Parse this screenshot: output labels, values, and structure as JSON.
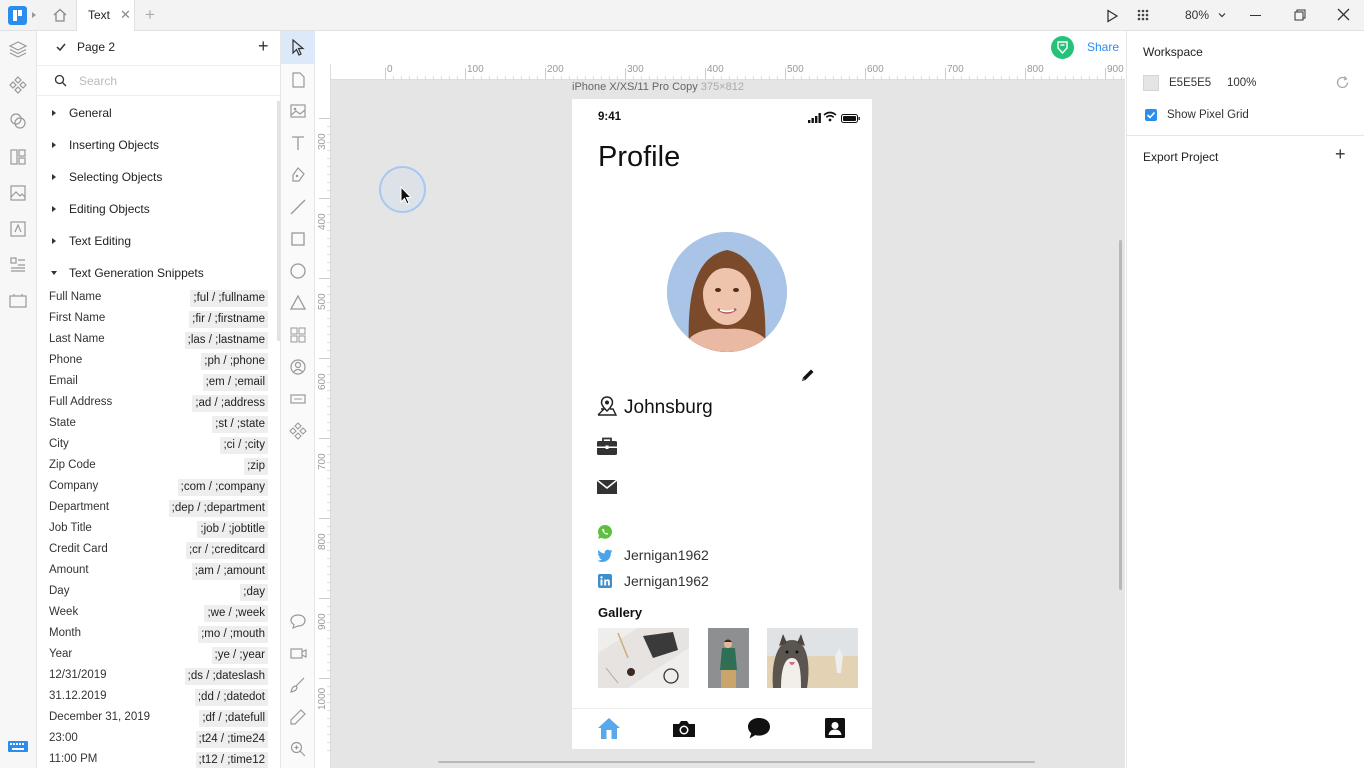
{
  "window": {
    "tab_title": "Text",
    "zoom": "80%"
  },
  "toolbar": {
    "share_label": "Share"
  },
  "left_panel": {
    "page_name": "Page 2",
    "search_placeholder": "Search",
    "sections": [
      {
        "label": "General",
        "expanded": false
      },
      {
        "label": "Inserting Objects",
        "expanded": false
      },
      {
        "label": "Selecting Objects",
        "expanded": false
      },
      {
        "label": "Editing Objects",
        "expanded": false
      },
      {
        "label": "Text Editing",
        "expanded": false
      },
      {
        "label": "Text Generation Snippets",
        "expanded": true
      }
    ],
    "snippets": [
      {
        "name": "Full Name",
        "code": ";ful / ;fullname"
      },
      {
        "name": "First Name",
        "code": ";fir / ;firstname"
      },
      {
        "name": "Last Name",
        "code": ";las / ;lastname"
      },
      {
        "name": "Phone",
        "code": ";ph / ;phone"
      },
      {
        "name": "Email",
        "code": ";em / ;email"
      },
      {
        "name": "Full Address",
        "code": ";ad / ;address"
      },
      {
        "name": "State",
        "code": ";st / ;state"
      },
      {
        "name": "City",
        "code": ";ci / ;city"
      },
      {
        "name": "Zip Code",
        "code": ";zip"
      },
      {
        "name": "Company",
        "code": ";com / ;company"
      },
      {
        "name": "Department",
        "code": ";dep / ;department"
      },
      {
        "name": "Job Title",
        "code": ";job / ;jobtitle"
      },
      {
        "name": "Credit Card",
        "code": ";cr / ;creditcard"
      },
      {
        "name": "Amount",
        "code": ";am / ;amount"
      },
      {
        "name": "Day",
        "code": ";day"
      },
      {
        "name": "Week",
        "code": ";we / ;week"
      },
      {
        "name": "Month",
        "code": ";mo / ;mouth"
      },
      {
        "name": "Year",
        "code": ";ye / ;year"
      },
      {
        "name": "12/31/2019",
        "code": ";ds / ;dateslash"
      },
      {
        "name": "31.12.2019",
        "code": ";dd / ;datedot"
      },
      {
        "name": "December 31, 2019",
        "code": ";df / ;datefull"
      },
      {
        "name": "23:00",
        "code": ";t24 / ;time24"
      },
      {
        "name": "11:00 PM",
        "code": ";t12 / ;time12"
      }
    ]
  },
  "ruler": {
    "h_marks": [
      "0",
      "100",
      "200",
      "300",
      "400",
      "500",
      "600",
      "700",
      "800",
      "900"
    ],
    "v_marks": [
      "300",
      "400",
      "500",
      "600",
      "700",
      "800",
      "900",
      "1000"
    ]
  },
  "artboard": {
    "name": "iPhone X/XS/11 Pro Copy",
    "size": "375×812"
  },
  "phone": {
    "time": "9:41",
    "title": "Profile",
    "location": "Johnsburg",
    "twitter": "Jernigan1962",
    "linkedin": "Jernigan1962",
    "gallery_title": "Gallery"
  },
  "right_panel": {
    "workspace_label": "Workspace",
    "color_hex": "E5E5E5",
    "opacity": "100%",
    "show_pixel_grid_label": "Show Pixel Grid",
    "show_pixel_grid": true,
    "export_label": "Export Project"
  },
  "colors": {
    "accent": "#2b8ded",
    "workspace_bg": "#E5E5E5",
    "share_green": "#27c27a",
    "whatsapp": "#5fbf3f",
    "twitter": "#4ba3e8",
    "linkedin": "#3d8ecb"
  }
}
